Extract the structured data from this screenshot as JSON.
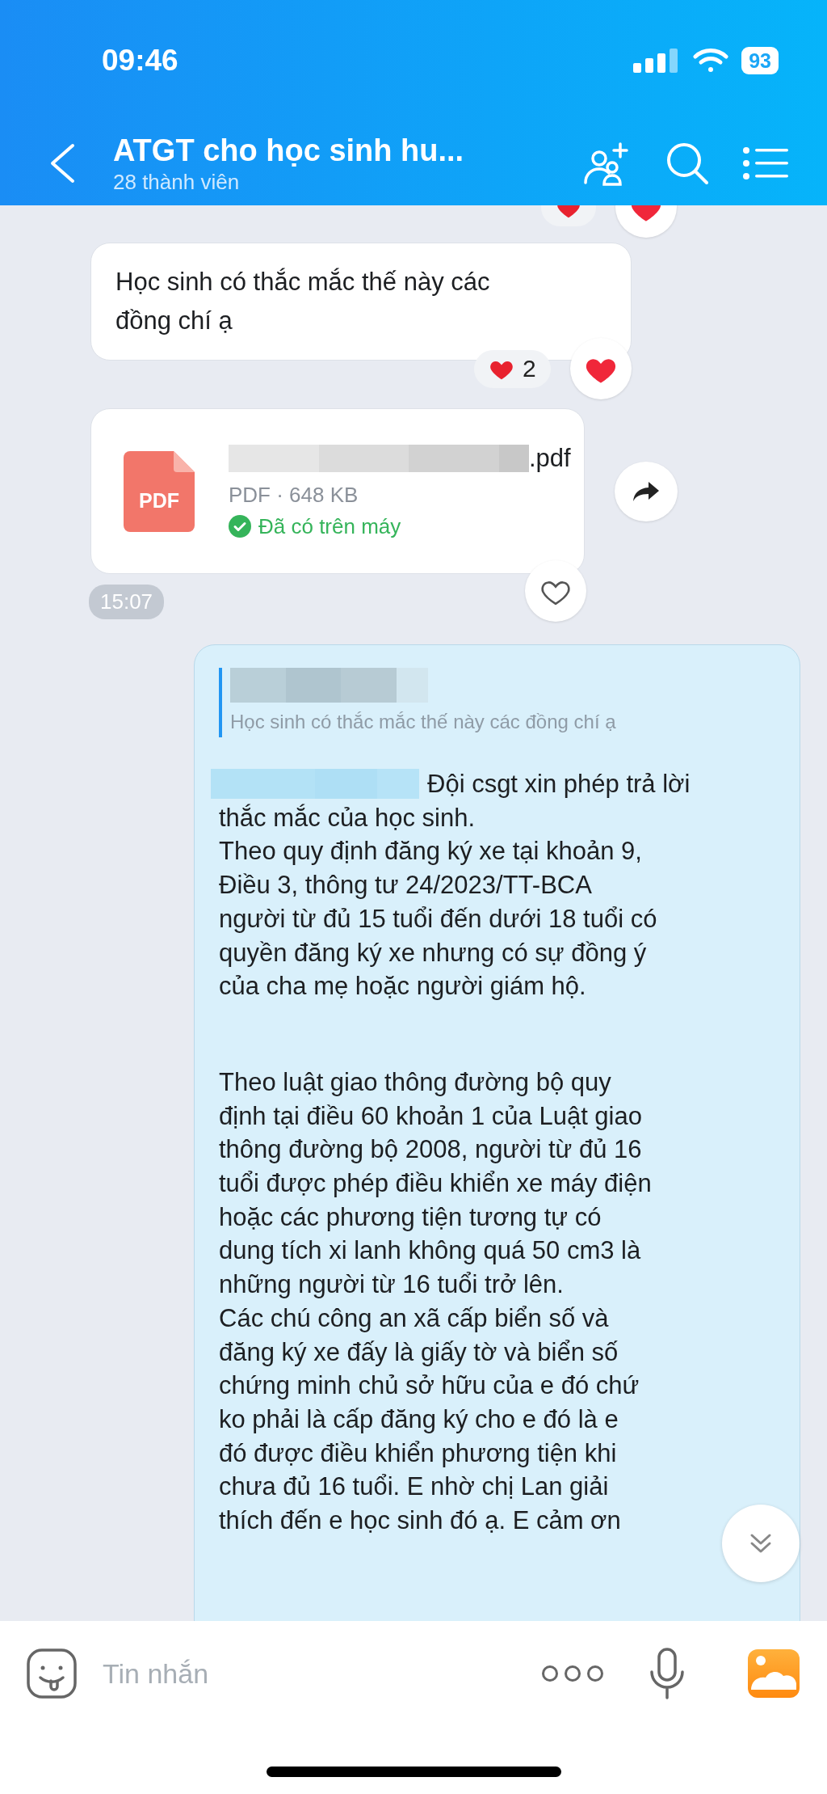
{
  "status_bar": {
    "time": "09:46",
    "battery": "93"
  },
  "header": {
    "title": "ATGT cho học sinh hu...",
    "subtitle": "28 thành viên"
  },
  "previous_reactions": {
    "liked": true
  },
  "messages": [
    {
      "kind": "text",
      "text": "Học sinh có thắc mắc thế này các\nđồng chí ạ",
      "reaction_count": "2",
      "liked": true
    },
    {
      "kind": "file",
      "icon_label": "PDF",
      "file_extension": ".pdf",
      "file_info": "PDF · 648 KB",
      "download_status": "Đã có trên máy",
      "liked": false,
      "time": "15:07"
    },
    {
      "kind": "reply",
      "quote_text": "Học sinh có thắc mắc thế này các đồng chí ạ",
      "mention_line": "Đội csgt xin phép trả lời",
      "paragraphs": [
        "thắc mắc của học sinh.\nTheo quy định đăng ký xe tại khoản 9,\nĐiều 3, thông tư 24/2023/TT-BCA\nngười từ đủ 15 tuổi đến dưới 18 tuổi có\nquyền đăng ký xe nhưng có sự đồng ý\ncủa cha mẹ hoặc người giám hộ.",
        "Theo luật giao thông đường bộ quy\nđịnh tại điều 60 khoản 1 của Luật giao\nthông đường bộ 2008, người từ đủ 16\ntuổi được phép điều khiển xe máy điện\nhoặc các phương tiện tương tự có\ndung tích xi lanh không quá 50 cm3 là\nnhững người từ 16 tuổi trở lên.\nCác chú công an xã cấp biển số và\nđăng ký xe đấy là giấy tờ và biển số\nchứng minh chủ sở hữu của e đó chứ\nko phải là cấp đăng ký cho e đó là e\nđó được điều khiển phương tiện khi\nchưa đủ 16 tuổi. E nhờ chị Lan giải\nthích đến e học sinh đó ạ. E cảm ơn"
      ]
    }
  ],
  "input": {
    "placeholder": "Tin nhắn"
  }
}
